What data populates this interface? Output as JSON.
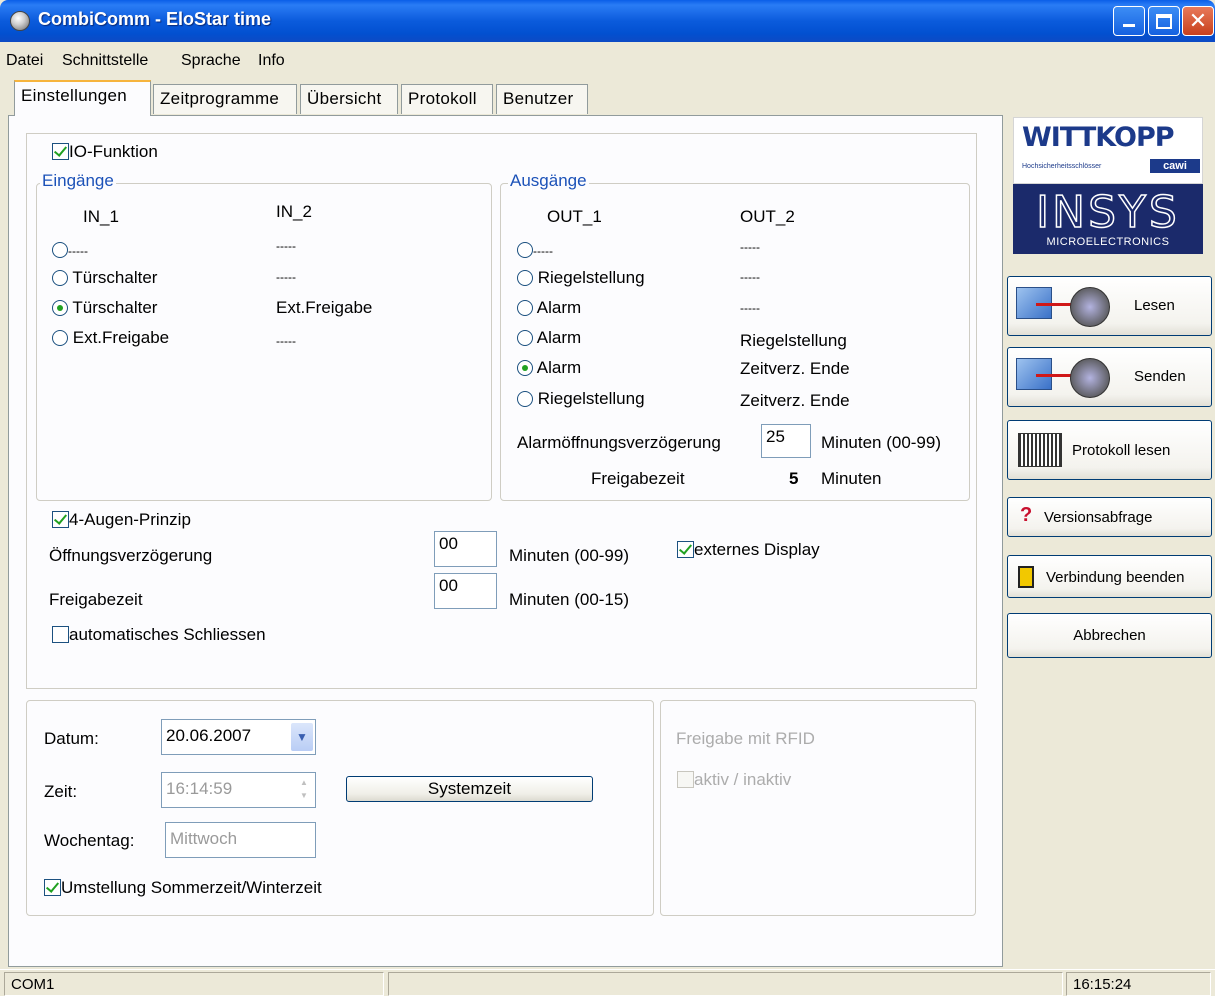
{
  "window": {
    "title": "CombiComm - EloStar time"
  },
  "menu": [
    {
      "label": "Datei"
    },
    {
      "label": "Schnittstelle"
    },
    {
      "label": "Sprache"
    },
    {
      "label": "Info"
    }
  ],
  "tabs": [
    "Einstellungen",
    "Zeitprogramme",
    "Übersicht",
    "Protokoll",
    "Benutzer"
  ],
  "io": {
    "function_label": "IO-Funktion",
    "inputs": {
      "title": "Eingänge",
      "col1": "IN_1",
      "col2": "IN_2",
      "rows": [
        {
          "in1": "-----",
          "in2": "-----",
          "selected": false
        },
        {
          "in1": "Türschalter",
          "in2": "-----",
          "selected": false
        },
        {
          "in1": "Türschalter",
          "in2": "Ext.Freigabe",
          "selected": true
        },
        {
          "in1": "Ext.Freigabe",
          "in2": "-----",
          "selected": false
        }
      ]
    },
    "outputs": {
      "title": "Ausgänge",
      "col1": "OUT_1",
      "col2": "OUT_2",
      "rows": [
        {
          "out1": "-----",
          "out2": "-----",
          "selected": false
        },
        {
          "out1": "Riegelstellung",
          "out2": "-----",
          "selected": false
        },
        {
          "out1": "Alarm",
          "out2": "-----",
          "selected": false
        },
        {
          "out1": "Alarm",
          "out2": "Riegelstellung",
          "selected": false
        },
        {
          "out1": "Alarm",
          "out2": "Zeitverz. Ende",
          "selected": true
        },
        {
          "out1": "Riegelstellung",
          "out2": "Zeitverz. Ende",
          "selected": false
        }
      ],
      "alarm_delay_label": "Alarmöffnungsverzögerung",
      "alarm_delay_value": "25",
      "alarm_delay_unit": "Minuten (00-99)",
      "release_label": "Freigabezeit",
      "release_value": "5",
      "release_unit": "Minuten"
    }
  },
  "four_eyes": {
    "label": "4-Augen-Prinzip",
    "open_delay_label": "Öffnungsverzögerung",
    "open_delay_value": "00",
    "open_delay_unit": "Minuten (00-99)",
    "release_label": "Freigabezeit",
    "release_value": "00",
    "release_unit": "Minuten (00-15)",
    "auto_close_label": "automatisches Schliessen",
    "ext_display_label": "externes Display"
  },
  "datetime": {
    "date_label": "Datum:",
    "date_value": "20.06.2007",
    "time_label": "Zeit:",
    "time_value": "16:14:59",
    "systime_button": "Systemzeit",
    "weekday_label": "Wochentag:",
    "weekday_value": "Mittwoch",
    "dst_label": "Umstellung Sommerzeit/Winterzeit"
  },
  "rfid": {
    "title": "Freigabe mit RFID",
    "active_label": "aktiv / inaktiv"
  },
  "logos": {
    "wittkopp": "WITTKOPP",
    "wittkopp_sub": "Hochsicherheitsschlösser",
    "cawi": "cawi",
    "insys": "INSYS",
    "insys_sub": "MICROELECTRONICS"
  },
  "side_buttons": {
    "read": "Lesen",
    "send": "Senden",
    "protocol": "Protokoll lesen",
    "version": "Versionsabfrage",
    "disconnect": "Verbindung beenden",
    "cancel": "Abbrechen"
  },
  "status": {
    "port": "COM1",
    "clock": "16:15:24"
  }
}
